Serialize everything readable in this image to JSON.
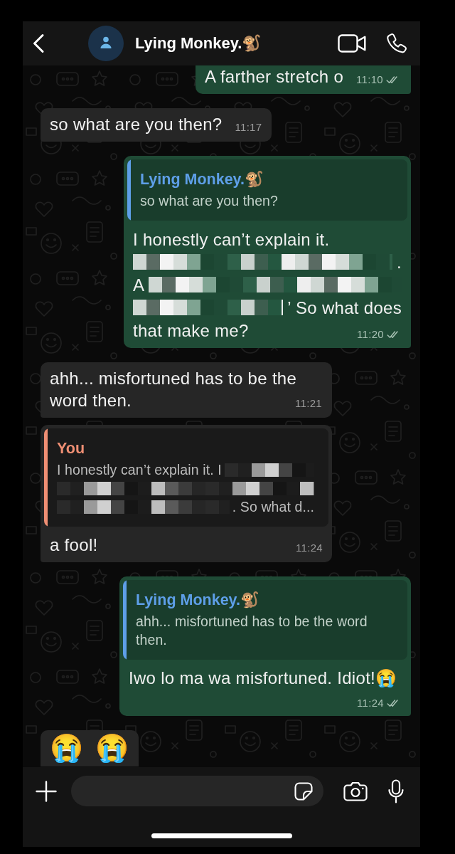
{
  "header": {
    "contact_name": "Lying Monkey.🐒"
  },
  "messages": [
    {
      "kind": "text",
      "outgoing": true,
      "clipped_top": true,
      "clipped_bottom": false,
      "text": "A farther stretch o",
      "time": "11:10",
      "read": false
    },
    {
      "kind": "text",
      "outgoing": false,
      "clipped_top": false,
      "clipped_bottom": false,
      "text": "so what are you then?",
      "time": "11:17"
    },
    {
      "kind": "text",
      "outgoing": true,
      "clipped_top": false,
      "clipped_bottom": false,
      "quote": {
        "author": "Lying Monkey.🐒",
        "color": "#5e9fe8",
        "text": "so what are you then?"
      },
      "lines": [
        [
          {
            "kind": "text",
            "text": "I honestly can’t explain it."
          }
        ],
        [
          {
            "kind": "redacted"
          },
          {
            "kind": "text",
            "text": "."
          }
        ],
        [
          {
            "kind": "text",
            "text": "A"
          },
          {
            "kind": "redacted"
          }
        ],
        [
          {
            "kind": "redacted"
          },
          {
            "kind": "text",
            "text": "’"
          },
          {
            "kind": "text",
            "text": "So what does"
          }
        ],
        [
          {
            "kind": "text",
            "text": "that make me?"
          }
        ]
      ],
      "time": "11:20",
      "read": false
    },
    {
      "kind": "text",
      "outgoing": false,
      "clipped_top": false,
      "clipped_bottom": false,
      "text": "ahh... misfortuned has to be the word then.",
      "time": "11:21"
    },
    {
      "kind": "text",
      "outgoing": false,
      "clipped_top": false,
      "clipped_bottom": false,
      "quote": {
        "author": "You",
        "color": "#ef8f74",
        "lines": [
          [
            {
              "kind": "text",
              "text": "I honestly can’t explain it. I"
            },
            {
              "kind": "redacted"
            }
          ],
          [
            {
              "kind": "redacted"
            }
          ],
          [
            {
              "kind": "redacted"
            },
            {
              "kind": "text",
              "text": ". So what d..."
            }
          ]
        ]
      },
      "text": "a fool!",
      "time": "11:24"
    },
    {
      "kind": "text",
      "outgoing": true,
      "clipped_top": false,
      "clipped_bottom": false,
      "quote": {
        "author": "Lying Monkey.🐒",
        "color": "#5e9fe8",
        "text": "ahh... misfortuned has to be the word then."
      },
      "text": "Iwo lo ma wa misfortuned. Idiot!😭",
      "time": "11:24",
      "read": false
    },
    {
      "kind": "emoji",
      "outgoing": false,
      "clipped_top": false,
      "clipped_bottom": true,
      "text": "😭 😭"
    }
  ]
}
